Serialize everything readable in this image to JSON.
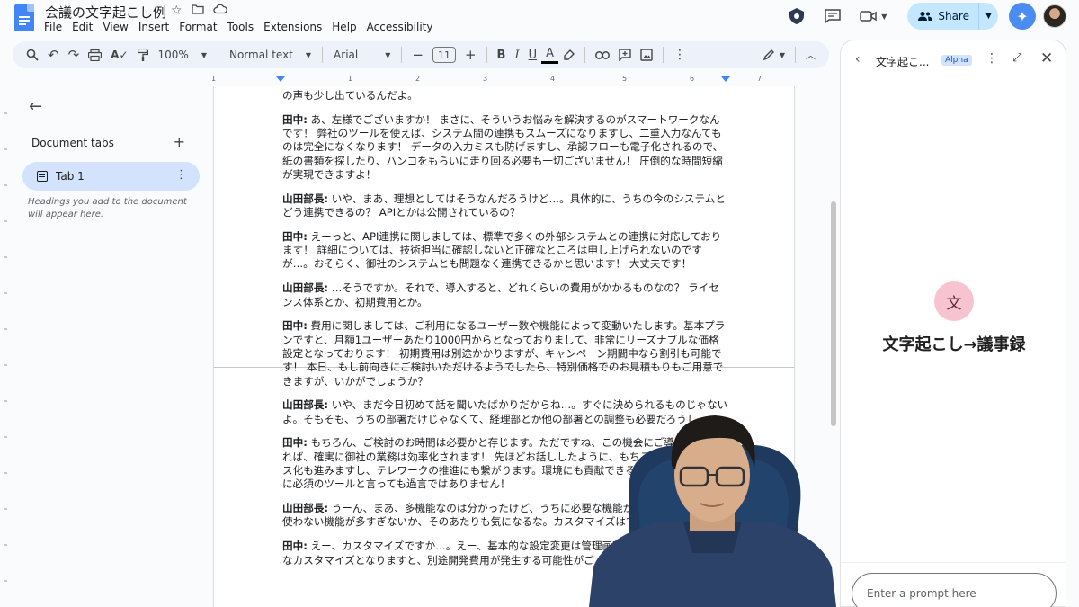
{
  "doc": {
    "title": "会議の文字起こし例",
    "menu": [
      "File",
      "Edit",
      "View",
      "Insert",
      "Format",
      "Tools",
      "Extensions",
      "Help",
      "Accessibility"
    ]
  },
  "header": {
    "share_label": "Share"
  },
  "toolbar": {
    "zoom": "100%",
    "style": "Normal text",
    "font": "Arial",
    "font_size": "11"
  },
  "ruler": {
    "ticks": [
      "1",
      "1",
      "2",
      "3",
      "4",
      "5",
      "6",
      "7"
    ]
  },
  "sidebar": {
    "heading": "Document tabs",
    "tab_label": "Tab 1",
    "hint": "Headings you add to the document will appear here."
  },
  "document": {
    "paragraphs": [
      {
        "speaker": "",
        "text": "の声も少し出ているんだよ。"
      },
      {
        "speaker": "田中:",
        "text": " あ、左様でございますか！ まさに、そういうお悩みを解決するのがスマートワークなんです！ 弊社のツールを使えば、システム間の連携もスムーズになりますし、二重入力なんてものは完全になくなります！ データの入力ミスも防げますし、承認フローも電子化されるので、紙の書類を探したり、ハンコをもらいに走り回る必要も一切ございません！ 圧倒的な時間短縮が実現できますよ！"
      },
      {
        "speaker": "山田部長:",
        "text": " いや、まあ、理想としてはそうなんだろうけど…。具体的に、うちの今のシステムとどう連携できるの？ APIとかは公開されているの？"
      },
      {
        "speaker": "田中:",
        "text": " えーっと、API連携に関しましては、標準で多くの外部システムとの連携に対応しております！ 詳細については、技術担当に確認しないと正確なところは申し上げられないのですが…。おそらく、御社のシステムとも問題なく連携できるかと思います！ 大丈夫です！"
      },
      {
        "speaker": "山田部長:",
        "text": " …そうですか。それで、導入すると、どれくらいの費用がかかるものなの？ ライセンス体系とか、初期費用とか。"
      },
      {
        "speaker": "田中:",
        "text": " 費用に関しましては、ご利用になるユーザー数や機能によって変動いたします。基本プランですと、月額1ユーザーあたり1000円からとなっておりまして、非常にリーズナブルな価格設定となっております！ 初期費用は別途かかりますが、キャンペーン期間中なら割引も可能です！ 本日、もし前向きにご検討いただけるようでしたら、特別価格でのお見積もりもご用意できますが、いかがでしょうか？"
      },
      {
        "speaker": "山田部長:",
        "text": " いや、まだ今日初めて話を聞いたばかりだからね…。すぐに決められるものじゃないよ。そもそも、うちの部署だけじゃなくて、経理部とか他の部署との調整も必要だろうし。"
      },
      {
        "speaker": "田中:",
        "text": " もちろん、ご検討のお時間は必要かと存じます。ただですね、この機会にご導入いただければ、確実に御社の業務は効率化されます！ 先ほどお話ししたように、もちろん、ペーパーレス化も進みますし、テレワークの推進にも繋がります。環境にも貢献できる、まさに今の時代に必須のツールと言っても過言ではありません！"
      },
      {
        "speaker": "山田部長:",
        "text": " うーん、まあ、多機能なのは分かったけど、うちに必要な機能が全部あるのか、逆に使わない機能が多すぎないか、そのあたりも気になるな。カスタマイズはできるの？"
      },
      {
        "speaker": "田中:",
        "text": " えー、カスタマイズですか…。えー、基本的な設定変更は管理画面から可能ですが、大幅なカスタマイズとなりますと、別途開発費用が発生する可能性がございます。"
      }
    ]
  },
  "panel": {
    "title": "文字起こ...",
    "badge": "Alpha",
    "icon_glyph": "文",
    "heading": "文字起こし→議事録",
    "prompt_placeholder": "Enter a prompt here"
  }
}
